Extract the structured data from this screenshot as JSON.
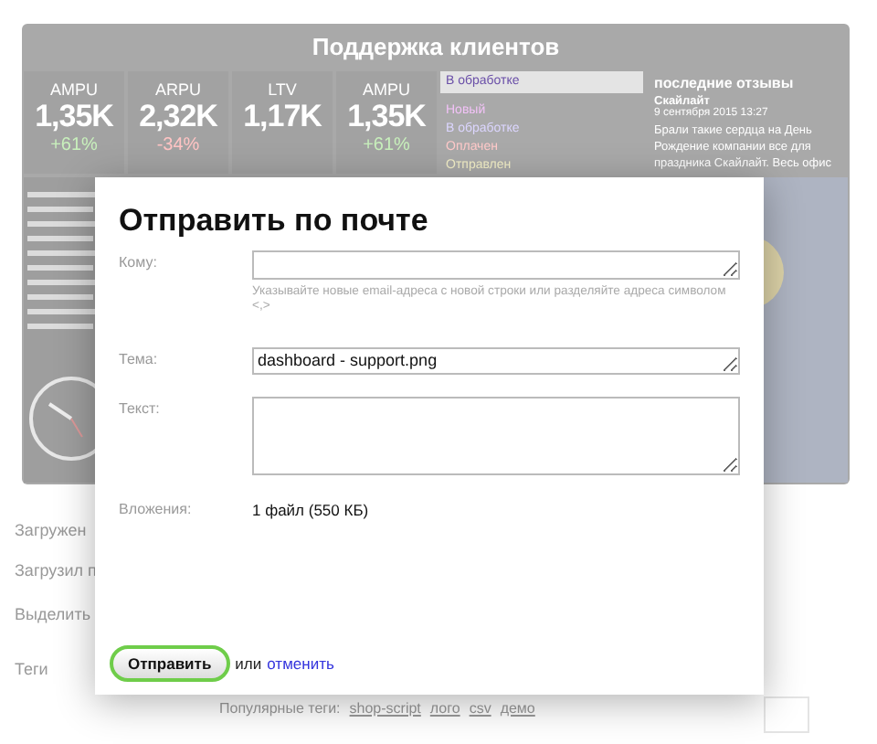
{
  "dashboard": {
    "title": "Поддержка клиентов",
    "stats": [
      {
        "label": "AMPU",
        "value": "1,35K",
        "change": "+61%",
        "color": "#c8f0bc"
      },
      {
        "label": "ARPU",
        "value": "2,32K",
        "change": "-34%",
        "color": "#ffc4c4"
      },
      {
        "label": "LTV",
        "value": "1,17K"
      },
      {
        "label": "AMPU",
        "value": "1,35K",
        "change": "+61%",
        "color": "#c8f0bc"
      }
    ],
    "statuses": [
      {
        "label": "В обработке",
        "selected": true,
        "color": "#6a4fa8"
      },
      {
        "label": "Новый",
        "selected": false,
        "color": "#f2c2f7"
      },
      {
        "label": "В обработке",
        "selected": false,
        "color": "#dcd6ff"
      },
      {
        "label": "Оплачен",
        "selected": false,
        "color": "#ffcaca"
      },
      {
        "label": "Отправлен",
        "selected": false,
        "color": "#f4f0c8"
      }
    ],
    "reviews": {
      "heading": "последние отзывы",
      "author": "Скайлайт",
      "date": "9 сентября 2015 13:27",
      "text": "Брали такие сердца на День Рождение компании все для праздника Скайлайт. Весь офис"
    }
  },
  "page_form": {
    "labels": [
      "Загружен",
      "Загрузил п",
      "Выделить",
      "Теги"
    ],
    "popular_tags_label": "Популярные теги:",
    "tags": [
      "shop-script",
      "лого",
      "csv",
      "демо"
    ]
  },
  "email_dialog": {
    "title": "Отправить по почте",
    "to": {
      "label": "Кому:",
      "hint": "Указывайте новые email-адреса с новой строки или разделяйте адреса символом <,>"
    },
    "subject": {
      "label": "Тема:",
      "value": "dashboard - support.png"
    },
    "message": {
      "label": "Текст:"
    },
    "attachments": {
      "label": "Вложения:",
      "value": "1 файл (550 КБ)"
    },
    "submit": "Отправить",
    "or": "или",
    "cancel": "отменить"
  }
}
